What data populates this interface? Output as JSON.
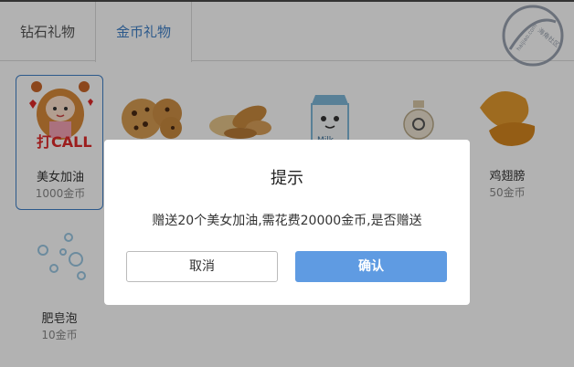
{
  "tabs": [
    {
      "label": "钻石礼物"
    },
    {
      "label": "金币礼物"
    }
  ],
  "watermark": {
    "text": "海角社区",
    "sub": "haijiao.com"
  },
  "gifts": [
    {
      "name": "美女加油",
      "price": "1000金币",
      "icon": "cheer-girl-icon"
    },
    {
      "name": "",
      "price": "",
      "icon": "cookies-icon"
    },
    {
      "name": "",
      "price": "",
      "icon": "bread-icon"
    },
    {
      "name": "",
      "price": "",
      "icon": "milk-carton-icon"
    },
    {
      "name": "",
      "price": "",
      "icon": "money-bag-icon"
    },
    {
      "name": "鸡翅膀",
      "price": "50金币",
      "icon": "chicken-wing-icon"
    },
    {
      "name": "肥皂泡",
      "price": "10金币",
      "icon": "soap-bubbles-icon"
    }
  ],
  "dialog": {
    "title": "提示",
    "message": "赠送20个美女加油,需花费20000金币,是否赠送",
    "cancel_label": "取消",
    "confirm_label": "确认"
  },
  "colors": {
    "accent": "#3f80c8",
    "confirm": "#5f9be2",
    "overlay": "rgba(0,0,0,0.30)"
  }
}
